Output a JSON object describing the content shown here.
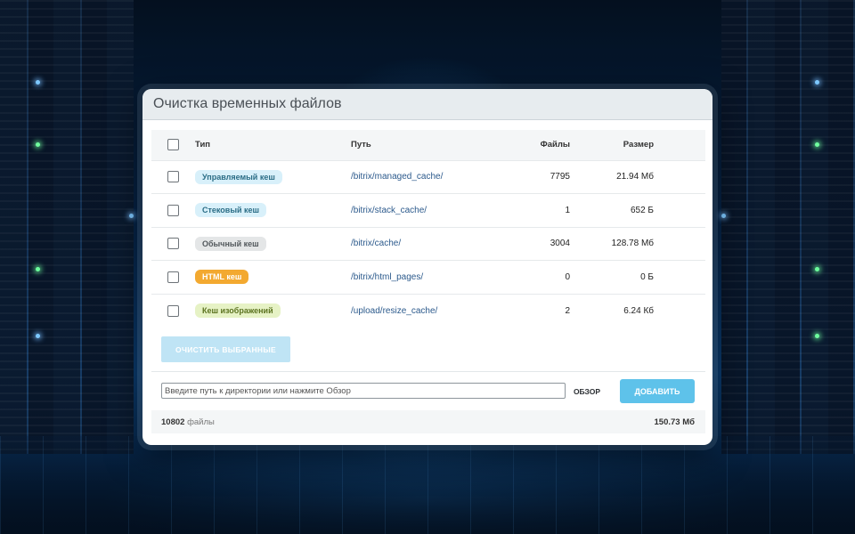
{
  "window": {
    "title": "Очистка временных файлов"
  },
  "table": {
    "headers": {
      "type": "Тип",
      "path": "Путь",
      "files": "Файлы",
      "size": "Размер"
    },
    "rows": [
      {
        "type": "Управляемый кеш",
        "path": "/bitrix/managed_cache/",
        "files": "7795",
        "size": "21.94 Мб",
        "checked": false
      },
      {
        "type": "Стековый кеш",
        "path": "/bitrix/stack_cache/",
        "files": "1",
        "size": "652 Б",
        "checked": false
      },
      {
        "type": "Обычный кеш",
        "path": "/bitrix/cache/",
        "files": "3004",
        "size": "128.78 Мб",
        "checked": false
      },
      {
        "type": "HTML кеш",
        "path": "/bitrix/html_pages/",
        "files": "0",
        "size": "0 Б",
        "checked": false
      },
      {
        "type": "Кеш изображений",
        "path": "/upload/resize_cache/",
        "files": "2",
        "size": "6.24 Кб",
        "checked": false
      }
    ]
  },
  "actions": {
    "clear_label": "ОЧИСТИТЬ ВЫБРАННЫЕ",
    "input_value": "",
    "input_placeholder": "Введите путь к директории или нажмите Обзор",
    "browse_label": "ОБЗОР",
    "add_label": "ДОБАВИТЬ"
  },
  "footer": {
    "count": "10802",
    "count_label": "файлы",
    "total": "150.73 Мб"
  },
  "colors": {
    "accent": "#5ec2ea",
    "accent_disabled": "#bfe4f5",
    "badge_html": "#f3a930",
    "link": "#2c5a8c"
  }
}
